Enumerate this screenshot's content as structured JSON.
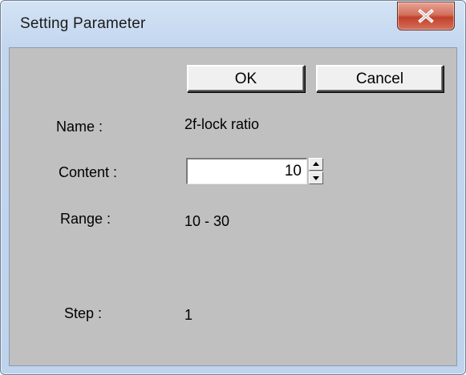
{
  "window": {
    "title": "Setting Parameter",
    "close_icon": "close-x-icon"
  },
  "buttons": {
    "ok_label": "OK",
    "cancel_label": "Cancel"
  },
  "fields": {
    "name_label": "Name :",
    "name_value": "2f-lock ratio",
    "content_label": "Content :",
    "content_value": "10",
    "range_label": "Range :",
    "range_value": "10 - 30",
    "step_label": "Step :",
    "step_value": "1"
  },
  "spinner": {
    "up_icon": "spin-up-arrow-icon",
    "down_icon": "spin-down-arrow-icon"
  },
  "colors": {
    "dialog_background": "#c0c0c0",
    "title_bar": "#c7d9ef",
    "close_button": "#c84a36"
  }
}
